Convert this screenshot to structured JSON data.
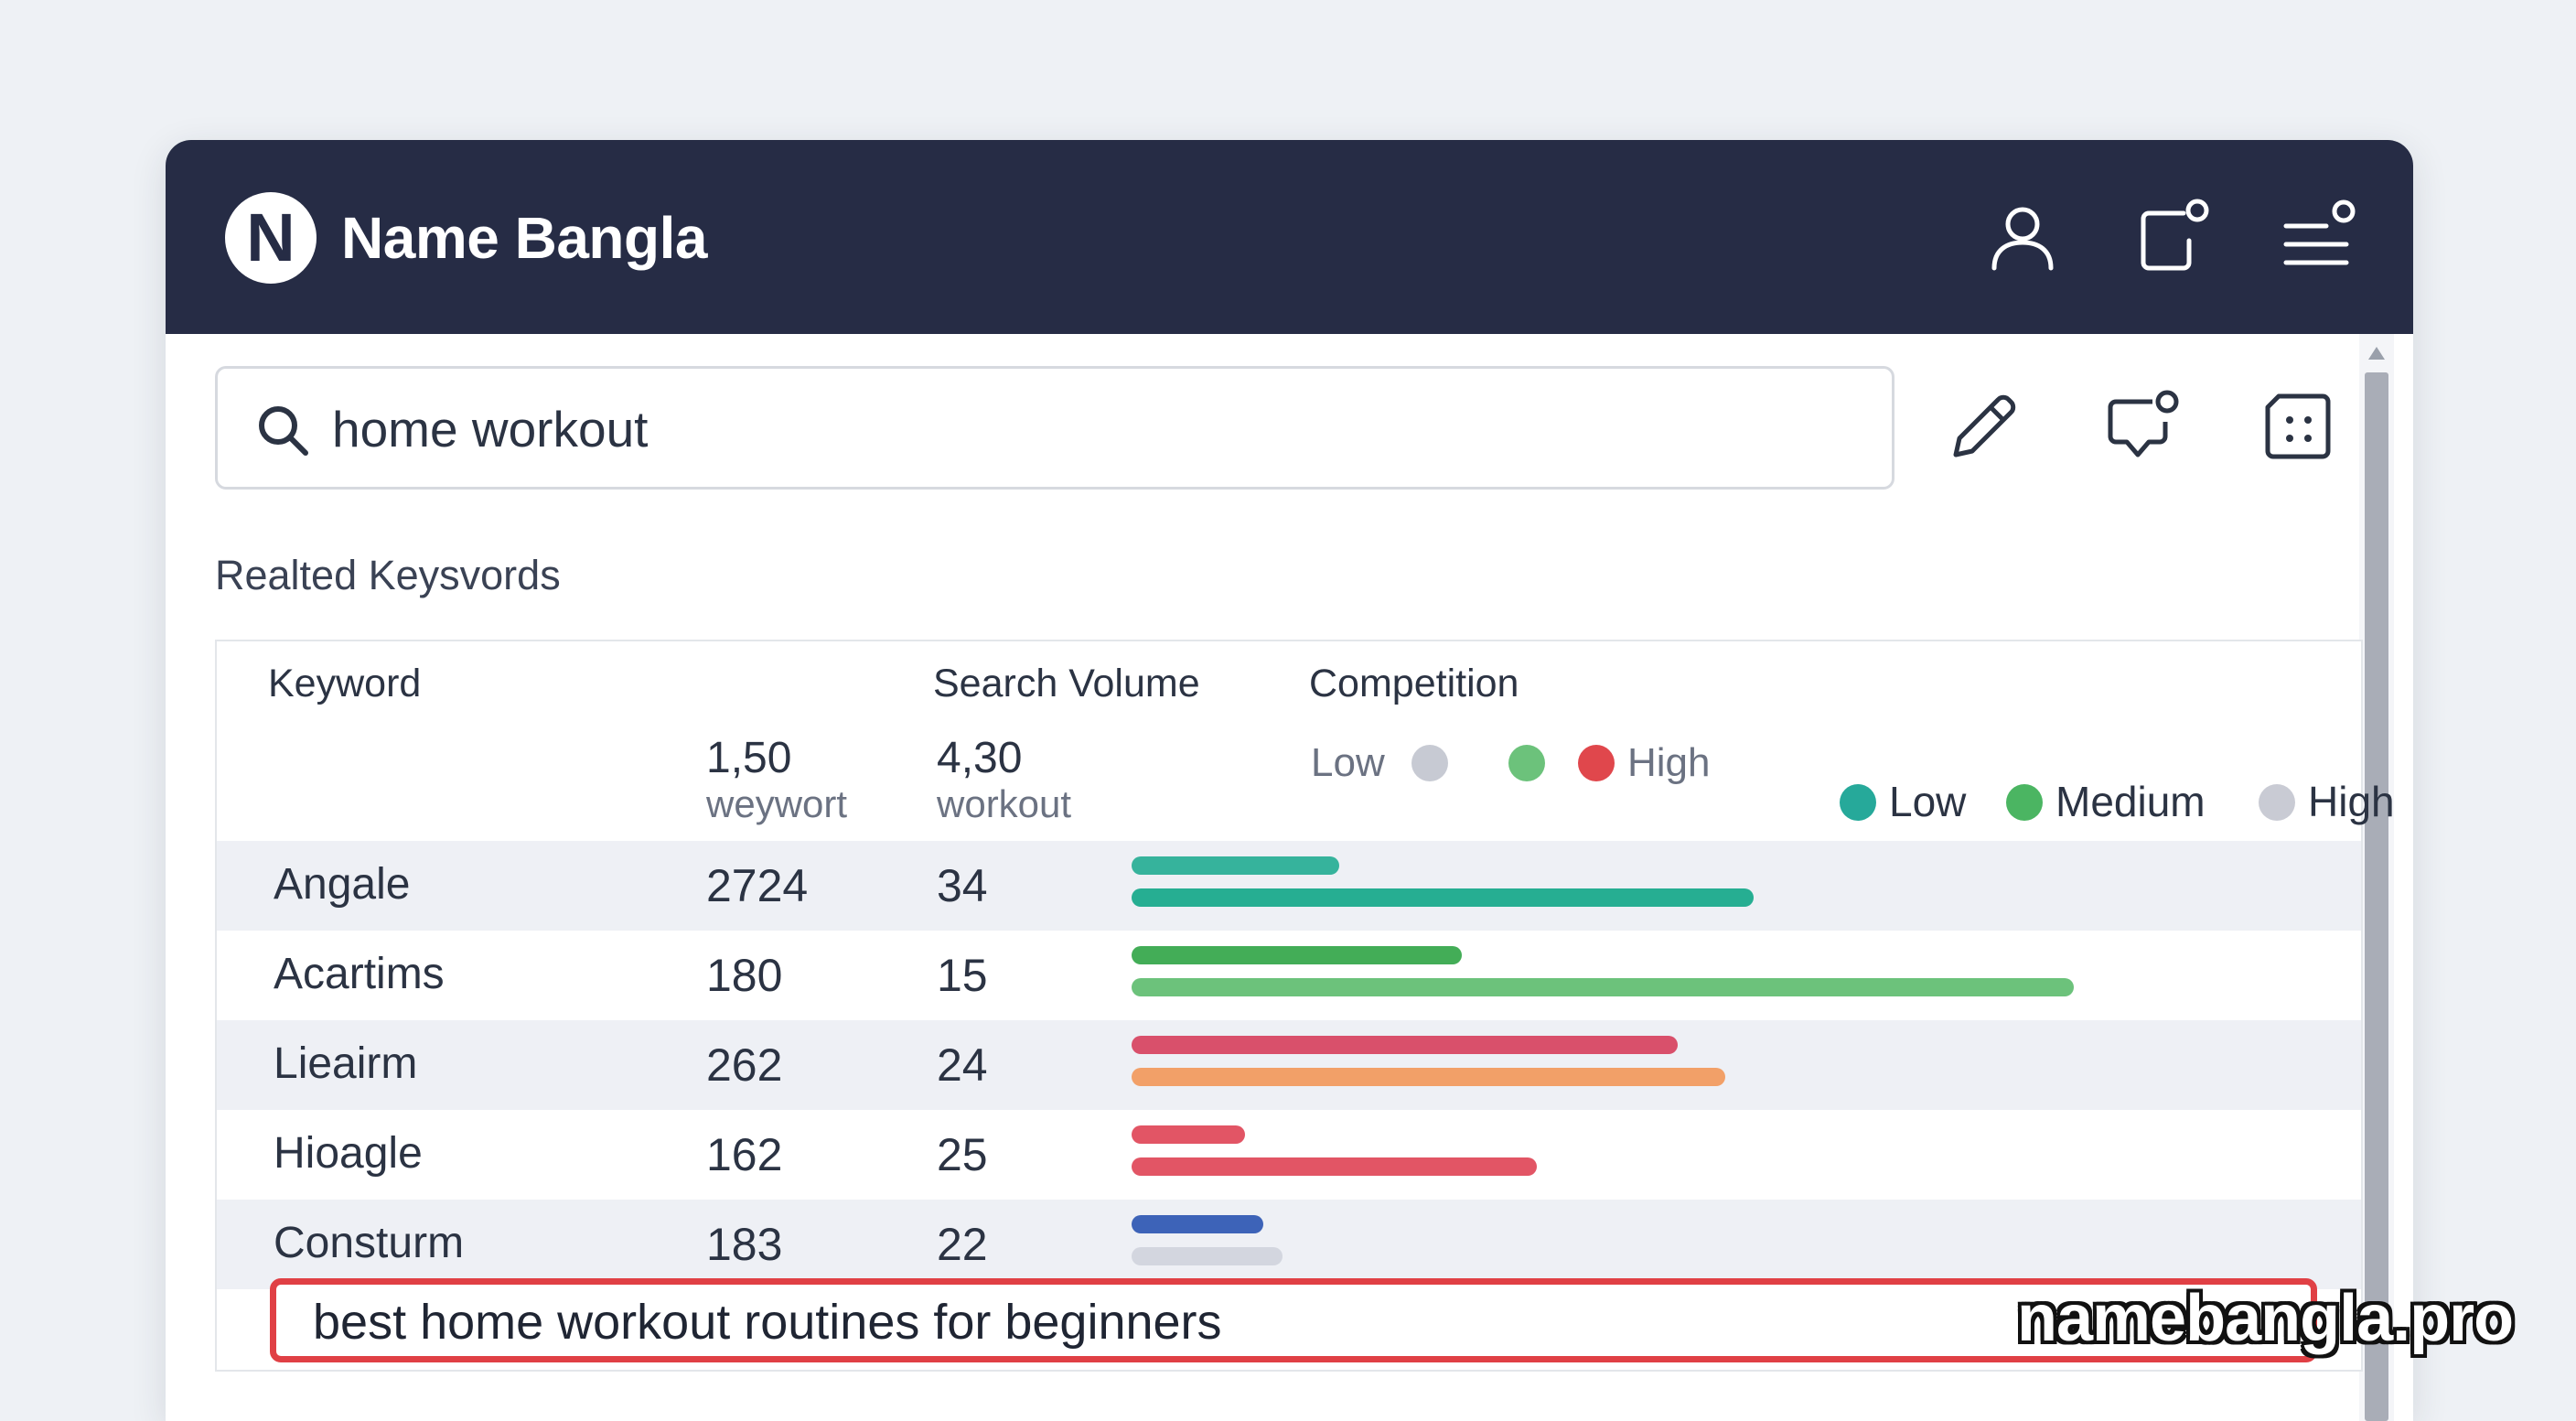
{
  "app": {
    "logo_letter": "N",
    "title": "Name Bangla"
  },
  "header_icons": [
    "user-icon",
    "notification-icon",
    "menu-icon"
  ],
  "search": {
    "value": "home workout",
    "placeholder": ""
  },
  "toolbar_icons": [
    "pencil-icon",
    "comment-icon",
    "grid-icon"
  ],
  "section": {
    "title": "Realted Keysvords"
  },
  "table": {
    "headers": {
      "keyword": "Keyword",
      "search_volume": "Search Volume",
      "competition": "Competition"
    },
    "subheader": {
      "col1_num": "1,50",
      "col1_label": "weywort",
      "col2_num": "4,30",
      "col2_label": "workout",
      "comp_low": "Low",
      "comp_high": "High"
    },
    "legend": [
      {
        "label": "Low",
        "color": "#26a99a"
      },
      {
        "label": "Medium",
        "color": "#4bb562"
      },
      {
        "label": "High",
        "color": "#c9cbd4"
      }
    ],
    "comp_dots": [
      "#c7cad3",
      "#6cc27b",
      "#e0474c"
    ],
    "rows": [
      {
        "keyword": "Angale",
        "v1": "2724",
        "v2": "34",
        "bar1": 0.22,
        "bar2": 0.66,
        "c1": "#36b39c",
        "c2": "#26ae92"
      },
      {
        "keyword": "Acartims",
        "v1": "180",
        "v2": "15",
        "bar1": 0.35,
        "bar2": 1.0,
        "c1": "#43ad57",
        "c2": "#6cc27b"
      },
      {
        "keyword": "Lieairm",
        "v1": "262",
        "v2": "24",
        "bar1": 0.58,
        "bar2": 0.63,
        "c1": "#d9506b",
        "c2": "#f2a068"
      },
      {
        "keyword": "Hioagle",
        "v1": "162",
        "v2": "25",
        "bar1": 0.12,
        "bar2": 0.43,
        "c1": "#e25565",
        "c2": "#e25565"
      },
      {
        "keyword": "Consturm",
        "v1": "183",
        "v2": "22",
        "bar1": 0.14,
        "bar2": 0.16,
        "c1": "#3d63b8",
        "c2": "#d3d6df"
      }
    ]
  },
  "highlight": {
    "text": "best home workout routines for beginners"
  },
  "watermark": "namebangla.pro"
}
